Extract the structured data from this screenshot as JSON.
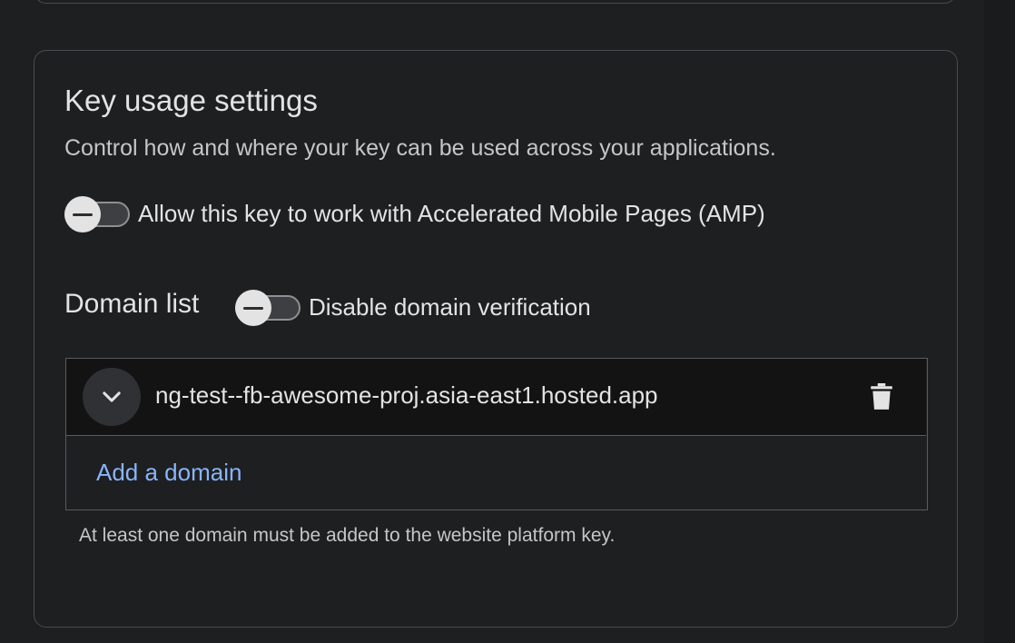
{
  "key_usage": {
    "title": "Key usage settings",
    "description": "Control how and where your key can be used across your applications.",
    "amp_toggle": {
      "label": "Allow this key to work with Accelerated Mobile Pages (AMP)",
      "checked": false
    }
  },
  "domain_list": {
    "title": "Domain list",
    "verification_toggle": {
      "label": "Disable domain verification",
      "checked": false
    },
    "domains": [
      {
        "name": "ng-test--fb-awesome-proj.asia-east1.hosted.app"
      }
    ],
    "add_label": "Add a domain",
    "helper_text": "At least one domain must be added to the website platform key."
  },
  "icons": {
    "expand": "chevron-down-icon",
    "delete": "trash-icon",
    "toggle_off": "minus-icon"
  },
  "colors": {
    "background": "#1e1f21",
    "border": "#4a4b4e",
    "text": "#e3e3e3",
    "secondary_text": "#c4c7c5",
    "link": "#8ab4f8",
    "row_background": "#131314"
  }
}
